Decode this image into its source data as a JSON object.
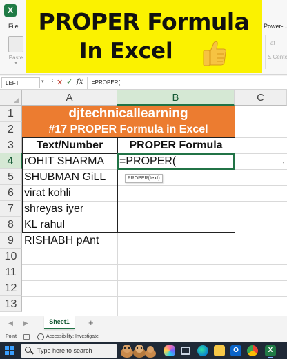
{
  "ribbon": {
    "file_tab": "File",
    "powerus_tab": "Power-us",
    "paste_label": "Paste",
    "paste_dropdown": "▾",
    "center_label": "& Center",
    "mini_label": "at"
  },
  "banner": {
    "line1": "PROPER Formula",
    "line2": "In Excel",
    "bg_color": "#fbf200"
  },
  "formula_bar": {
    "name_box": "LEFT",
    "name_dropdown": "▾",
    "dots": "⋮",
    "cancel_icon": "✕",
    "enter_icon": "✓",
    "fx_label": "fx",
    "content": "=PROPER("
  },
  "columns": [
    "A",
    "B",
    "C"
  ],
  "rows": [
    "1",
    "2",
    "3",
    "4",
    "5",
    "6",
    "7",
    "8",
    "9",
    "10",
    "11",
    "12",
    "13"
  ],
  "active": {
    "column": "B",
    "row": "4"
  },
  "sheet": {
    "title_row1": "djtechnicallearning",
    "title_row2": "#17 PROPER Formula in Excel",
    "header_a": "Text/Number",
    "header_b": "PROPER Formula",
    "names": [
      "rOHIT SHARMA",
      "SHUBMAN GiLL",
      "virat kohli",
      "shreyas iyer",
      "KL rahul",
      "RISHABH pAnt"
    ],
    "editing_cell": "=PROPER(",
    "title_color": "#ec7c30"
  },
  "tooltip": {
    "func": "PROPER(",
    "arg": "text",
    "close": ")"
  },
  "side_mark": "⌐",
  "sheet_tabs": {
    "prev": "◀",
    "next": "▶",
    "active_tab": "Sheet1",
    "add": "+"
  },
  "status": {
    "mode": "Point",
    "accessibility": "Accessibility: Investigate"
  },
  "taskbar": {
    "search_text": "Type here to search",
    "outlook_letter": "O",
    "excel_letter": "X"
  },
  "excel_logo_letter": "X",
  "colors": {
    "excel_green": "#217346",
    "active_header_bg": "#d5e8d4",
    "taskbar_bg": "#1f2936"
  },
  "icons": [
    "excel-logo-icon",
    "paste-icon",
    "cancel-icon",
    "enter-icon",
    "thumbs-up-icon",
    "windows-icon",
    "search-icon",
    "copilot-icon",
    "task-view-icon",
    "edge-icon",
    "file-explorer-icon",
    "outlook-icon",
    "chrome-icon",
    "excel-taskbar-icon"
  ]
}
